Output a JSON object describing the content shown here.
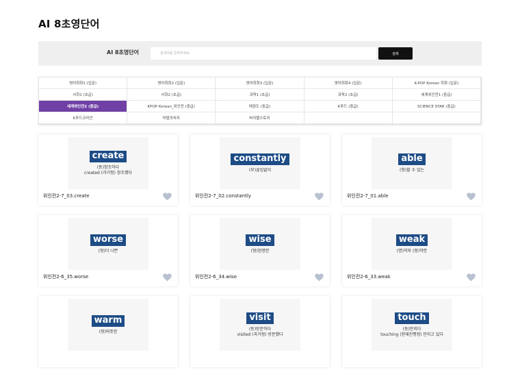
{
  "page": {
    "title": "AI 8초영단어"
  },
  "search": {
    "label": "AI 8초영단어",
    "placeholder": "검색어를 입력하세요.",
    "button_label": "검색"
  },
  "categories": [
    {
      "label": "영어회화1 (입문)",
      "active": false
    },
    {
      "label": "영어회화2 (입문)",
      "active": false
    },
    {
      "label": "영어회화3 (입문)",
      "active": false
    },
    {
      "label": "영어회화4 (입문)",
      "active": false
    },
    {
      "label": "K-POP Korean 회화 (입문)",
      "active": false
    },
    {
      "label": "사회1 (초급)",
      "active": false
    },
    {
      "label": "사회2 (초급)",
      "active": false
    },
    {
      "label": "과학1 (초급)",
      "active": false
    },
    {
      "label": "과학2 (초급)",
      "active": false
    },
    {
      "label": "세계위인전1 (중급)",
      "active": false
    },
    {
      "label": "세계위인전2 (중급)",
      "active": true
    },
    {
      "label": "KPOP Korean_위인전 (중급)",
      "active": false
    },
    {
      "label": "태권도 (중급)",
      "active": false
    },
    {
      "label": "K푸드 (중급)",
      "active": false
    },
    {
      "label": "SCIENCE STAR (중급)",
      "active": false
    },
    {
      "label": "K푸드코리안",
      "active": false
    },
    {
      "label": "마법의숙자",
      "active": false
    },
    {
      "label": "바이블스토리",
      "active": false
    }
  ],
  "cards": [
    {
      "word": "create",
      "meaning_1": "(동)창조하다",
      "meaning_2": "created (과거형) 창조했다",
      "title": "위인전2-7_03.create"
    },
    {
      "word": "constantly",
      "meaning_1": "(부)끊임없이",
      "meaning_2": "",
      "title": "위인전2-7_02.constantly"
    },
    {
      "word": "able",
      "meaning_1": "(형)할 수 있는",
      "meaning_2": "",
      "title": "위인전2-7_01.able"
    },
    {
      "word": "worse",
      "meaning_1": "(형)더 나쁜",
      "meaning_2": "",
      "title": "위인전2-6_35.worse"
    },
    {
      "word": "wise",
      "meaning_1": "(형)현명한",
      "meaning_2": "",
      "title": "위인전2-6_34.wise"
    },
    {
      "word": "weak",
      "meaning_1": "(명)약자 (형)약한",
      "meaning_2": "",
      "title": "위인전2-6_33.weak"
    },
    {
      "word": "warm",
      "meaning_1": "(형)따뜻한",
      "meaning_2": "",
      "title": ""
    },
    {
      "word": "visit",
      "meaning_1": "(동)방문하다",
      "meaning_2": "visited (과거형) 방문했다",
      "title": ""
    },
    {
      "word": "touch",
      "meaning_1": "(동)만지다",
      "meaning_2": "touching (현재진행형) 만지고 있다",
      "title": ""
    }
  ],
  "colors": {
    "accent_active": "#7040a6",
    "word_badge": "#1d4c86",
    "search_button": "#111111",
    "heart": "#b8c2ce"
  },
  "icons": {
    "card_favorite": "heart-icon"
  }
}
